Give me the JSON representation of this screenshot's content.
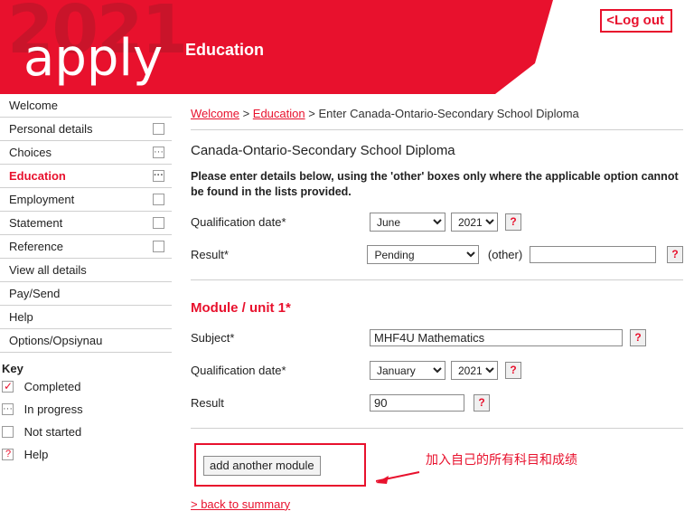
{
  "header": {
    "year": "2021",
    "brand": "apply",
    "section": "Education",
    "logout": "<Log out"
  },
  "sidebar": {
    "items": [
      {
        "label": "Welcome",
        "marker": "none"
      },
      {
        "label": "Personal details",
        "marker": "empty"
      },
      {
        "label": "Choices",
        "marker": "dots"
      },
      {
        "label": "Education",
        "marker": "dots",
        "active": true
      },
      {
        "label": "Employment",
        "marker": "empty"
      },
      {
        "label": "Statement",
        "marker": "empty"
      },
      {
        "label": "Reference",
        "marker": "empty"
      },
      {
        "label": "View all details",
        "marker": "none"
      },
      {
        "label": "Pay/Send",
        "marker": "none"
      },
      {
        "label": "Help",
        "marker": "none"
      },
      {
        "label": "Options/Opsiynau",
        "marker": "none"
      }
    ],
    "key_title": "Key",
    "key_items": [
      {
        "label": "Completed",
        "marker": "check"
      },
      {
        "label": "In progress",
        "marker": "dots"
      },
      {
        "label": "Not started",
        "marker": "empty"
      },
      {
        "label": "Help",
        "marker": "help"
      }
    ]
  },
  "breadcrumb": {
    "first": "Welcome",
    "sep1": " > ",
    "second": "Education",
    "sep2": " > ",
    "current": "Enter Canada-Ontario-Secondary School Diploma"
  },
  "main": {
    "page_title": "Canada-Ontario-Secondary School Diploma",
    "instructions": "Please enter details below, using the 'other' boxes only where the applicable option cannot be found in the lists provided.",
    "qualification_date_label": "Qualification date*",
    "qualification_month": "June",
    "qualification_year": "2021",
    "result_label": "Result*",
    "result_value": "Pending",
    "other_label": "(other)",
    "other_value": "",
    "help_label": "?",
    "module_title": "Module / unit 1*",
    "subject_label": "Subject*",
    "subject_value": "MHF4U Mathematics",
    "module_date_label": "Qualification date*",
    "module_month": "January",
    "module_year": "2021",
    "module_result_label": "Result",
    "module_result_value": "90",
    "add_module_label": "add another module",
    "annotation": "加入自己的所有科目和成绩",
    "back_link": "> back to summary"
  },
  "colors": {
    "brand_red": "#e8112d",
    "border_grey": "#cfcfcf"
  }
}
